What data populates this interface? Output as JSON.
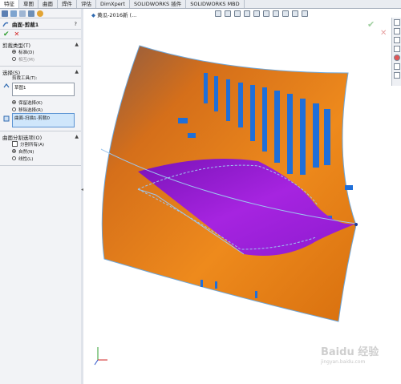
{
  "tabs": [
    "特征",
    "草图",
    "曲面",
    "焊件",
    "评估",
    "DimXpert",
    "SOLIDWORKS 插件",
    "SOLIDWORKS MBD"
  ],
  "active_tab": 0,
  "feature": {
    "title": "曲面-剪裁1",
    "help": "?"
  },
  "actions": {
    "ok": "✔",
    "cancel": "✕"
  },
  "trim_type": {
    "header": "剪裁类型(T)",
    "options": [
      "标准(D)",
      "相互(M)"
    ],
    "selected": 0
  },
  "selection": {
    "header": "选择(S)",
    "trim_tool_label": "剪裁工具(T):",
    "trim_tool_value": "草图1",
    "options": [
      "保留选择(K)",
      "移除选择(R)"
    ],
    "selected": 0,
    "kept_list_value": "曲面-扫描1-剪裁0"
  },
  "split_options": {
    "header": "曲面分割选项(O)",
    "split_all": "分割所有(A)",
    "options": [
      "自然(N)",
      "线性(L)"
    ],
    "selected": 0
  },
  "viewport": {
    "title": "黄瓜-2016新   (..."
  },
  "colors": {
    "surface_orange": "#e07a12",
    "trim_purple": "#9b1fd6",
    "hatch_blue": "#1f6fd9",
    "ok_green": "#2f9e2f",
    "cancel_red": "#d22020"
  },
  "watermark": {
    "text": "Baidu 经验",
    "sub": "jingyan.baidu.com"
  }
}
